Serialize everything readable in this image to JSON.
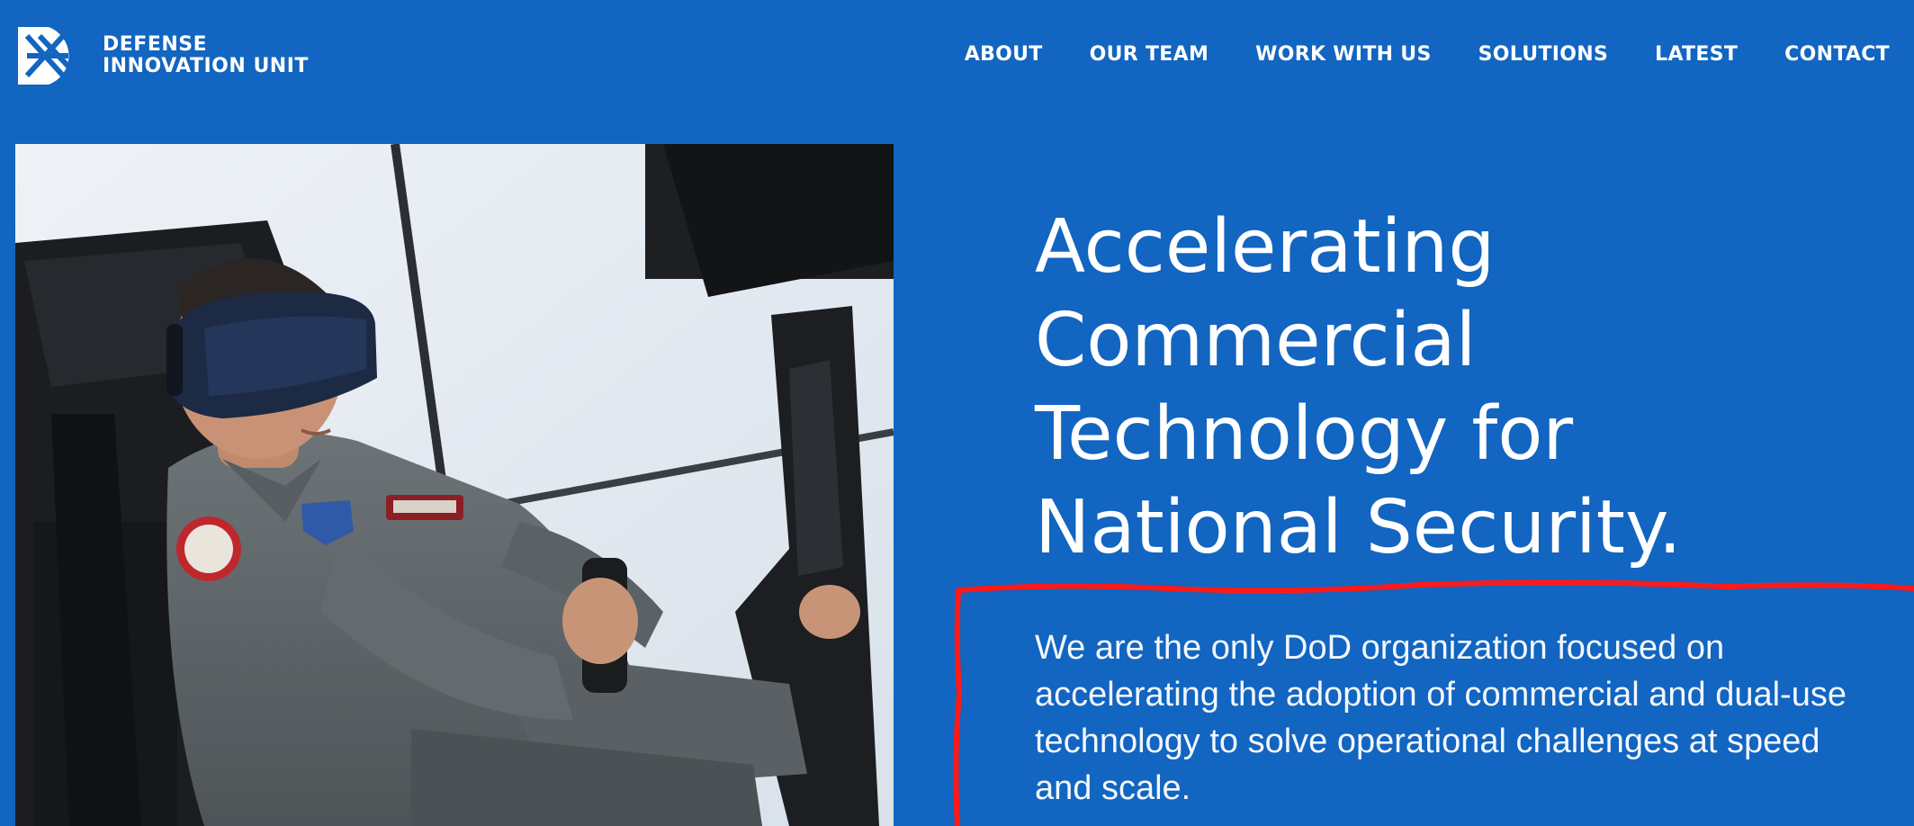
{
  "header": {
    "logo": {
      "line1": "DEFENSE",
      "line2": "INNOVATION UNIT",
      "icon": "diu-logo-icon"
    },
    "nav": [
      {
        "label": "ABOUT"
      },
      {
        "label": "OUR TEAM"
      },
      {
        "label": "WORK WITH US"
      },
      {
        "label": "SOLUTIONS"
      },
      {
        "label": "LATEST"
      },
      {
        "label": "CONTACT"
      }
    ]
  },
  "hero": {
    "headline": [
      "Accelerating",
      "Commercial",
      "Technology for",
      "National Security."
    ],
    "description": "We are the only DoD organization focused on accelerating the adoption of commercial and dual-use technology to solve operational challenges at speed and scale.",
    "image": "airman-in-vr-flight-simulator"
  },
  "colors": {
    "background": "#1265c0",
    "text": "#ffffff",
    "annotation": "#ff1a1a"
  }
}
